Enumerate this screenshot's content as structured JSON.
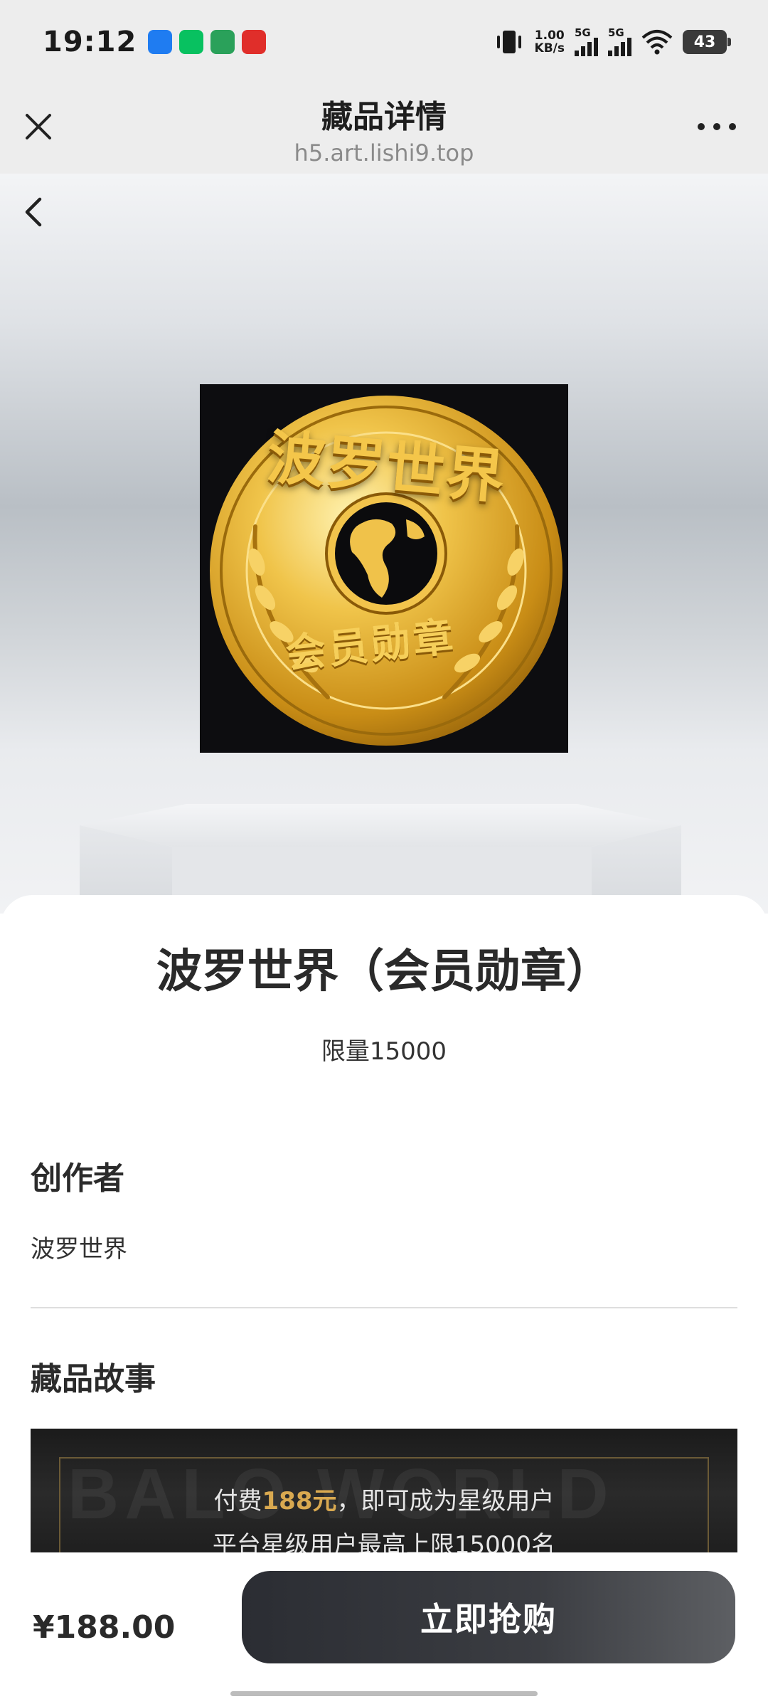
{
  "status_bar": {
    "time": "19:12",
    "net_speed_value": "1.00",
    "net_speed_unit": "KB/s",
    "signal1_label": "5G",
    "signal2_label": "5G",
    "battery": "43",
    "app_icons": [
      "dingtalk-icon",
      "wechat-icon",
      "bank-icon",
      "pay-icon"
    ],
    "app_icon_colors": [
      "#1f7cf1",
      "#08c160",
      "#2aa15a",
      "#e02e2a"
    ]
  },
  "header": {
    "title": "藏品详情",
    "url": "h5.art.lishi9.top"
  },
  "hero": {
    "medal_text_top": "波罗世界",
    "medal_text_bottom": "会员勋章"
  },
  "product": {
    "name": "波罗世界（会员勋章）",
    "limit": "限量15000"
  },
  "creator": {
    "heading": "创作者",
    "name": "波罗世界"
  },
  "story": {
    "heading": "藏品故事",
    "banner_bg_text": "BALO WORLD",
    "line1_prefix": "付费",
    "line1_highlight": "188元",
    "line1_suffix": "，即可成为星级用户",
    "line2": "平台星级用户最高上限15000名"
  },
  "bottom": {
    "price": "¥188.00",
    "buy_label": "立即抢购"
  },
  "colors": {
    "accent_gold": "#d9a950",
    "button_dark": "#2b2d33"
  }
}
